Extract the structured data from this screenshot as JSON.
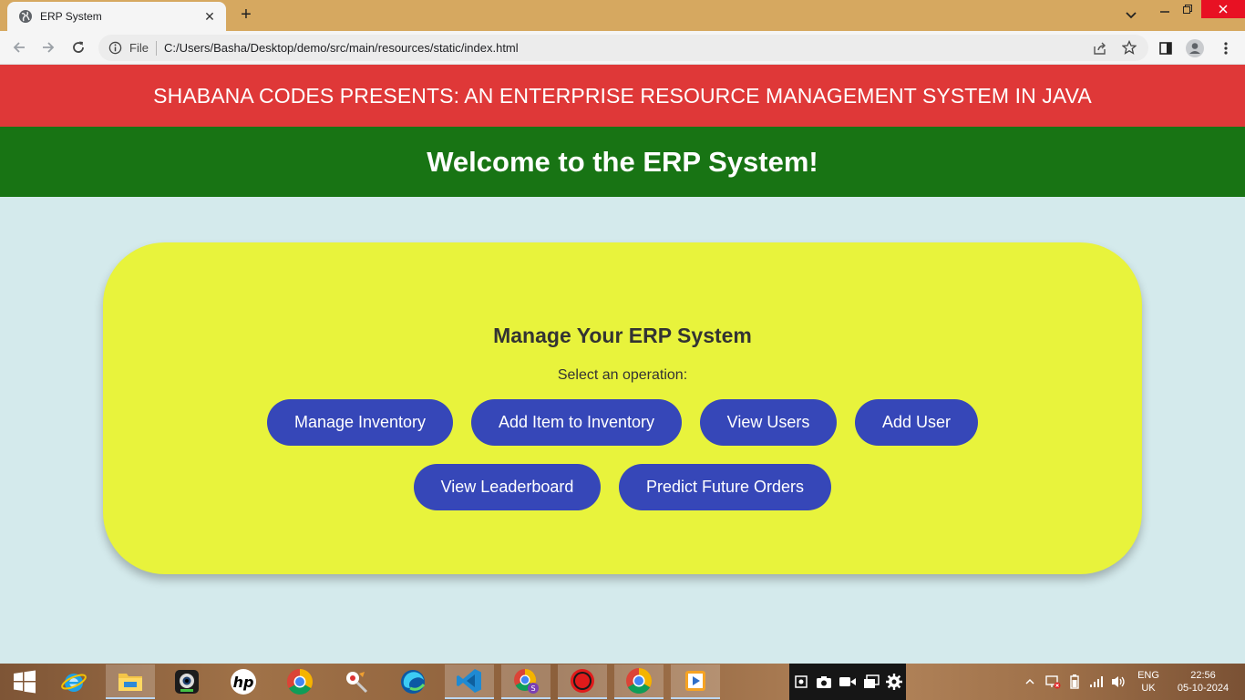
{
  "browser": {
    "tab_title": "ERP System",
    "tab_close": "✕",
    "new_tab": "+",
    "address_scheme": "File",
    "address_url": "C:/Users/Basha/Desktop/demo/src/main/resources/static/index.html",
    "icons": [
      "globe-icon",
      "chevron-down-icon",
      "minimize-icon",
      "maximize-icon",
      "close-icon",
      "back-icon",
      "forward-icon",
      "reload-icon",
      "info-icon",
      "share-icon",
      "star-icon",
      "side-panel-icon",
      "profile-icon",
      "menu-icon"
    ]
  },
  "page": {
    "banner": "SHABANA CODES PRESENTS: AN ENTERPRISE RESOURCE MANAGEMENT SYSTEM IN JAVA",
    "welcome": "Welcome to the ERP System!",
    "card": {
      "title": "Manage Your ERP System",
      "subtitle": "Select an operation:",
      "buttons": [
        {
          "label": "Manage Inventory"
        },
        {
          "label": "Add Item to Inventory"
        },
        {
          "label": "View Users"
        },
        {
          "label": "Add User"
        },
        {
          "label": "View Leaderboard"
        },
        {
          "label": "Predict Future Orders"
        }
      ]
    }
  },
  "taskbar": {
    "apps": [
      "windows-start-icon",
      "internet-explorer-icon",
      "file-explorer-icon",
      "webcam-icon",
      "hp-icon",
      "chrome-icon",
      "paint-tool-icon",
      "edge-icon",
      "vscode-icon",
      "chrome-profile-icon",
      "record-icon",
      "chrome-active-icon",
      "media-player-icon"
    ],
    "tray_icons": [
      "screenshot-icon",
      "camera-icon",
      "video-icon",
      "windows-icon",
      "settings-icon",
      "show-hidden-icon",
      "network-off-icon",
      "battery-icon",
      "signal-icon",
      "volume-icon"
    ],
    "language_top": "ENG",
    "language_bottom": "UK",
    "time": "22:56",
    "date": "05-10-2024"
  },
  "colors": {
    "banner_bg": "#df3838",
    "welcome_bg": "#187414",
    "page_bg": "#d4eaec",
    "card_bg": "#e8f33c",
    "button_bg": "#3647b8",
    "tabstrip_bg": "#d6a860"
  }
}
